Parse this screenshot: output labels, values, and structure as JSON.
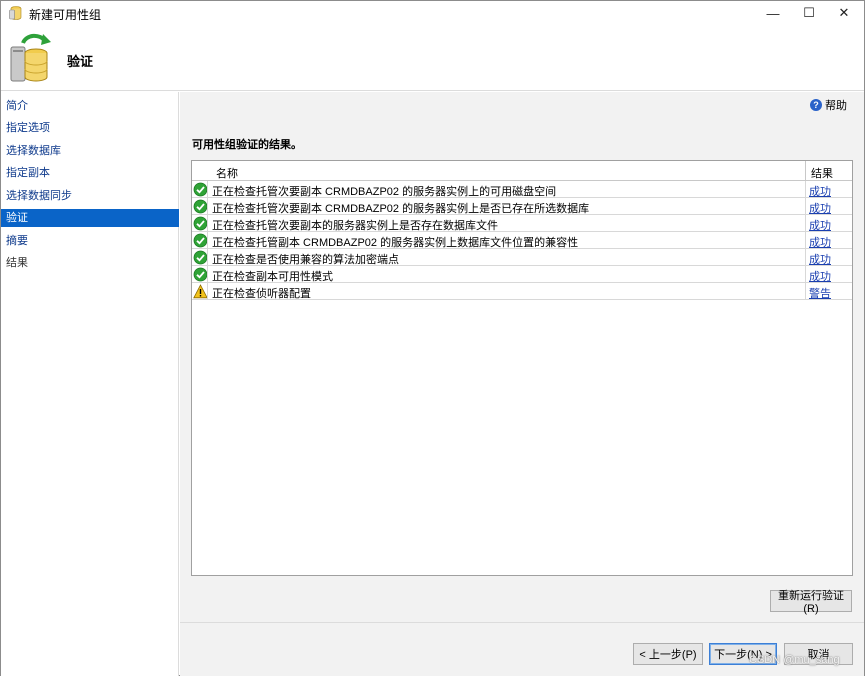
{
  "window": {
    "title": "新建可用性组",
    "controls": {
      "minimize": "—",
      "maximize": "☐",
      "close": "✕"
    }
  },
  "header": {
    "title": "验证",
    "icon": "database-refresh-icon"
  },
  "sidebar": {
    "items": [
      {
        "label": "简介",
        "state": "link"
      },
      {
        "label": "指定选项",
        "state": "link"
      },
      {
        "label": "选择数据库",
        "state": "link"
      },
      {
        "label": "指定副本",
        "state": "link"
      },
      {
        "label": "选择数据同步",
        "state": "link"
      },
      {
        "label": "验证",
        "state": "active"
      },
      {
        "label": "摘要",
        "state": "link"
      },
      {
        "label": "结果",
        "state": "disabled"
      }
    ]
  },
  "main": {
    "help_label": "帮助",
    "section_title": "可用性组验证的结果。",
    "grid": {
      "columns": [
        "名称",
        "结果"
      ],
      "rows": [
        {
          "status": "success",
          "name": "正在检查托管次要副本 CRMDBAZP02 的服务器实例上的可用磁盘空间",
          "result": "成功"
        },
        {
          "status": "success",
          "name": "正在检查托管次要副本 CRMDBAZP02 的服务器实例上是否已存在所选数据库",
          "result": "成功"
        },
        {
          "status": "success",
          "name": "正在检查托管次要副本的服务器实例上是否存在数据库文件",
          "result": "成功"
        },
        {
          "status": "success",
          "name": "正在检查托管副本 CRMDBAZP02 的服务器实例上数据库文件位置的兼容性",
          "result": "成功"
        },
        {
          "status": "success",
          "name": "正在检查是否使用兼容的算法加密端点",
          "result": "成功"
        },
        {
          "status": "success",
          "name": "正在检查副本可用性模式",
          "result": "成功"
        },
        {
          "status": "warning",
          "name": "正在检查侦听器配置",
          "result": "警告"
        }
      ]
    },
    "rerun_label": "重新运行验证(R)",
    "buttons": {
      "prev": "< 上一步(P)",
      "next": "下一步(N) >",
      "cancel": "取消"
    }
  },
  "watermark": "CSDN @mu_sang",
  "colors": {
    "accent": "#0a64c8",
    "link": "#1a3fb0",
    "success": "#2fa336",
    "warning": "#f2c21b"
  }
}
